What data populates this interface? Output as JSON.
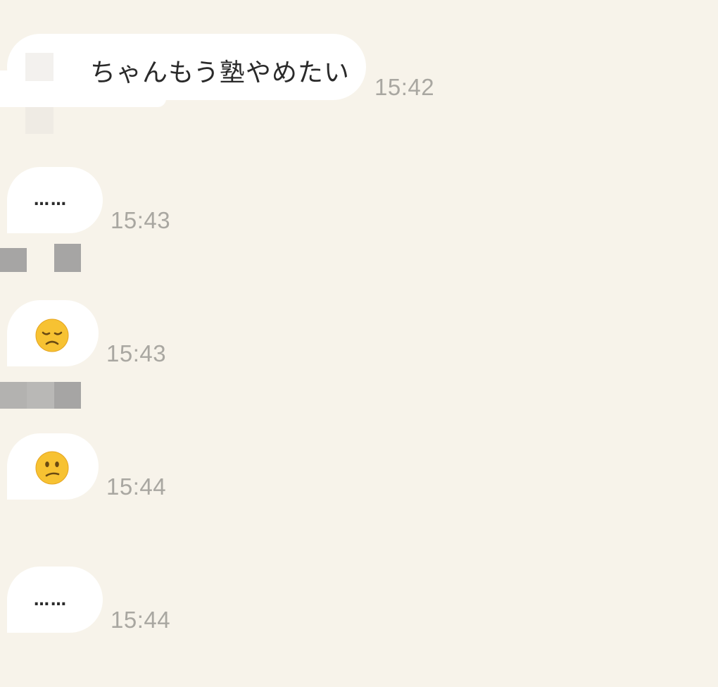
{
  "messages": [
    {
      "text": "ちゃんもう塾やめたい",
      "time": "15:42"
    },
    {
      "text": "……",
      "time": "15:43"
    },
    {
      "emoji": "disappointed-face",
      "time": "15:43"
    },
    {
      "emoji": "confused-face",
      "time": "15:44"
    },
    {
      "text": "……",
      "time": "15:44"
    }
  ],
  "colors": {
    "background": "#f7f3ea",
    "bubble": "#ffffff",
    "timestamp": "#a9a7a1",
    "emoji_face": "#f7c232"
  }
}
